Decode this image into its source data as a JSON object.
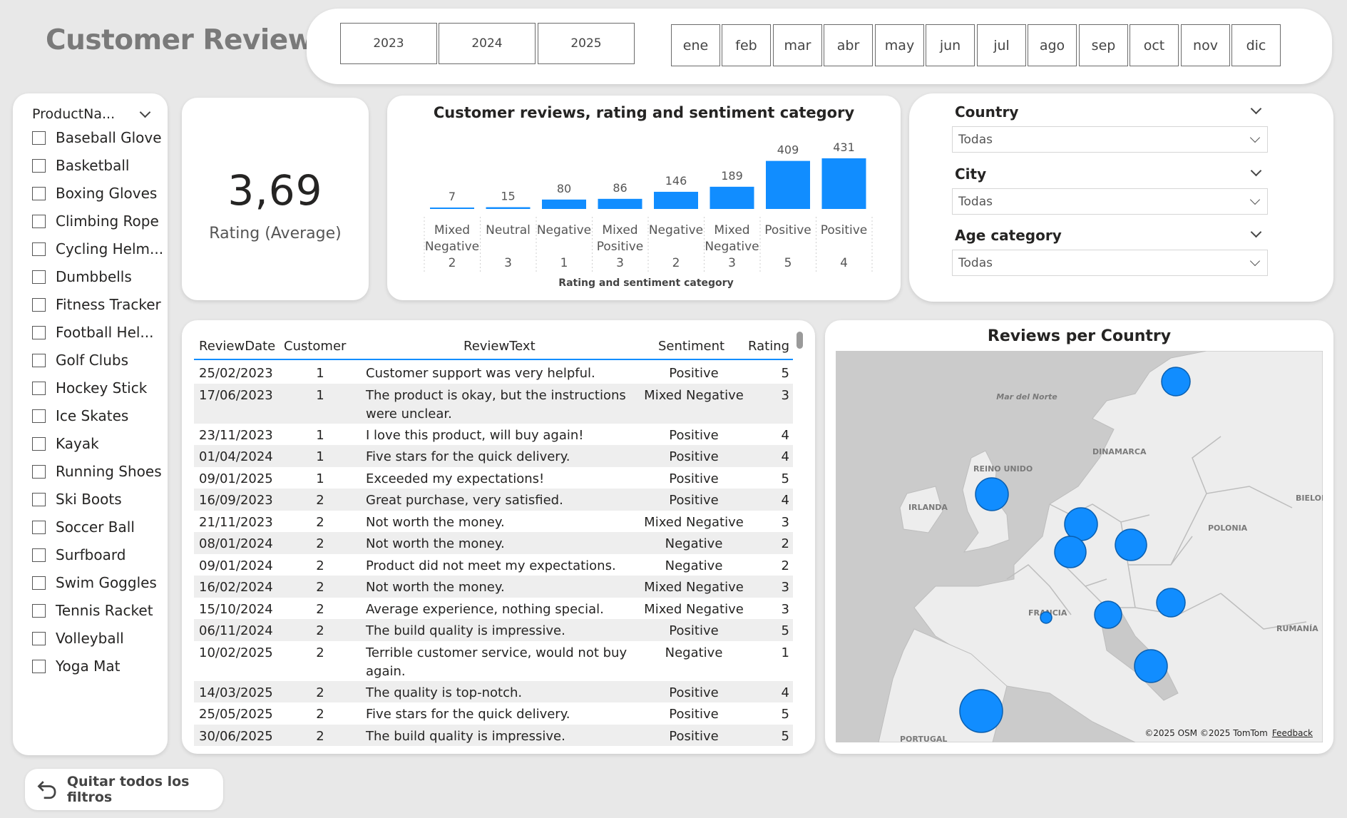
{
  "header": {
    "title": "Customer Review"
  },
  "years": [
    "2023",
    "2024",
    "2025"
  ],
  "months": [
    "ene",
    "feb",
    "mar",
    "abr",
    "may",
    "jun",
    "jul",
    "ago",
    "sep",
    "oct",
    "nov",
    "dic"
  ],
  "product_slicer": {
    "title": "ProductNa...",
    "items": [
      "Baseball Glove",
      "Basketball",
      "Boxing Gloves",
      "Climbing Rope",
      "Cycling Helm...",
      "Dumbbells",
      "Fitness Tracker",
      "Football Hel...",
      "Golf Clubs",
      "Hockey Stick",
      "Ice Skates",
      "Kayak",
      "Running Shoes",
      "Ski Boots",
      "Soccer Ball",
      "Surfboard",
      "Swim Goggles",
      "Tennis Racket",
      "Volleyball",
      "Yoga Mat"
    ]
  },
  "kpi": {
    "value": "3,69",
    "label": "Rating (Average)"
  },
  "chart_data": {
    "type": "bar",
    "title": "Customer reviews, rating and sentiment category",
    "xlabel": "Rating and sentiment category",
    "ylabel": "",
    "categories": [
      [
        "Mixed",
        "Negative",
        "2"
      ],
      [
        "Neutral",
        "",
        "3"
      ],
      [
        "Negative",
        "",
        "1"
      ],
      [
        "Mixed",
        "Positive",
        "3"
      ],
      [
        "Negative",
        "",
        "2"
      ],
      [
        "Mixed",
        "Negative",
        "3"
      ],
      [
        "Positive",
        "",
        "5"
      ],
      [
        "Positive",
        "",
        "4"
      ]
    ],
    "values": [
      7,
      15,
      80,
      86,
      146,
      189,
      409,
      431
    ],
    "ylim": [
      0,
      431
    ],
    "bar_color": "#118dff",
    "grid": false
  },
  "filters": {
    "country": {
      "label": "Country",
      "value": "Todas"
    },
    "city": {
      "label": "City",
      "value": "Todas"
    },
    "age": {
      "label": "Age category",
      "value": "Todas"
    }
  },
  "table": {
    "columns": [
      "ReviewDate",
      "Customer",
      "ReviewText",
      "Sentiment",
      "Rating"
    ],
    "rows": [
      [
        "25/02/2023",
        "1",
        "Customer support was very helpful.",
        "Positive",
        "5"
      ],
      [
        "17/06/2023",
        "1",
        "The product is okay, but the instructions were unclear.",
        "Mixed Negative",
        "3"
      ],
      [
        "23/11/2023",
        "1",
        "I love this product, will buy again!",
        "Positive",
        "4"
      ],
      [
        "01/04/2024",
        "1",
        "Five stars for the quick delivery.",
        "Positive",
        "4"
      ],
      [
        "09/01/2025",
        "1",
        "Exceeded my expectations!",
        "Positive",
        "5"
      ],
      [
        "16/09/2023",
        "2",
        "Great purchase, very satisfied.",
        "Positive",
        "4"
      ],
      [
        "21/11/2023",
        "2",
        "Not worth the money.",
        "Mixed Negative",
        "3"
      ],
      [
        "08/01/2024",
        "2",
        "Not worth the money.",
        "Negative",
        "2"
      ],
      [
        "09/01/2024",
        "2",
        "Product did not meet my expectations.",
        "Negative",
        "2"
      ],
      [
        "16/02/2024",
        "2",
        "Not worth the money.",
        "Mixed Negative",
        "3"
      ],
      [
        "15/10/2024",
        "2",
        "Average experience, nothing special.",
        "Mixed Negative",
        "3"
      ],
      [
        "06/11/2024",
        "2",
        "The build quality is impressive.",
        "Positive",
        "5"
      ],
      [
        "10/02/2025",
        "2",
        "Terrible customer service, would not buy again.",
        "Negative",
        "1"
      ],
      [
        "14/03/2025",
        "2",
        "The quality is top-notch.",
        "Positive",
        "4"
      ],
      [
        "25/05/2025",
        "2",
        "Five stars for the quick delivery.",
        "Positive",
        "5"
      ],
      [
        "30/06/2025",
        "2",
        "The build quality is impressive.",
        "Positive",
        "5"
      ]
    ]
  },
  "map": {
    "title": "Reviews per Country",
    "labels": [
      "Mar del Norte",
      "DINAMARCA",
      "REINO UNIDO",
      "IRLANDA",
      "POLONIA",
      "BIELOR",
      "FRANCIA",
      "RUMANÍA",
      "PORTUGAL"
    ],
    "attribution": "©2025 OSM  ©2025 TomTom",
    "feedback": "Feedback",
    "bubble_color": "#118dff"
  },
  "clear_filters": {
    "label": "Quitar todos los filtros"
  }
}
